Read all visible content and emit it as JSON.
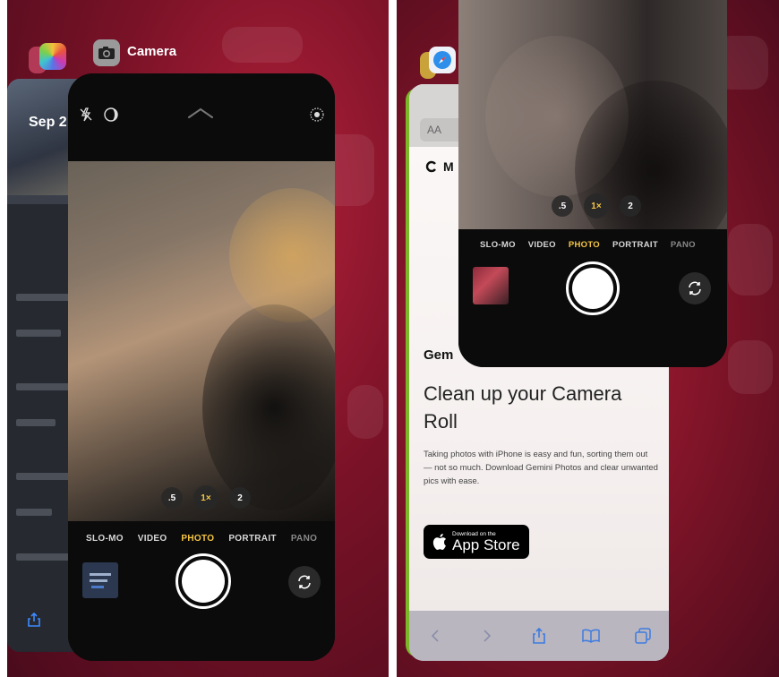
{
  "left": {
    "header_app_title": "Camera",
    "photos_card": {
      "date_text": "Sep 2"
    },
    "camera": {
      "zoom_levels": [
        ".5",
        "1×",
        "2"
      ],
      "modes": [
        "SLO-MO",
        "VIDEO",
        "PHOTO",
        "PORTRAIT",
        "PANO"
      ],
      "active_mode": "PHOTO"
    }
  },
  "right": {
    "camera": {
      "zoom_levels": [
        ".5",
        "1×",
        "2"
      ],
      "modes": [
        "SLO-MO",
        "VIDEO",
        "PHOTO",
        "PORTRAIT",
        "PANO"
      ],
      "active_mode": "PHOTO"
    },
    "safari": {
      "url_aa": "AA",
      "menu_text": "M",
      "brand_text": "Gem",
      "headline": "Clean up your Camera Roll",
      "body": "Taking photos with iPhone is easy and fun, sorting them out — not so much. Download Gemini Photos and clear unwanted pics with ease.",
      "appstore_small": "Download on the",
      "appstore_big": "App Store"
    }
  },
  "colors": {
    "accent_yellow": "#f7c744",
    "wallpaper_red": "#9c1a30"
  }
}
